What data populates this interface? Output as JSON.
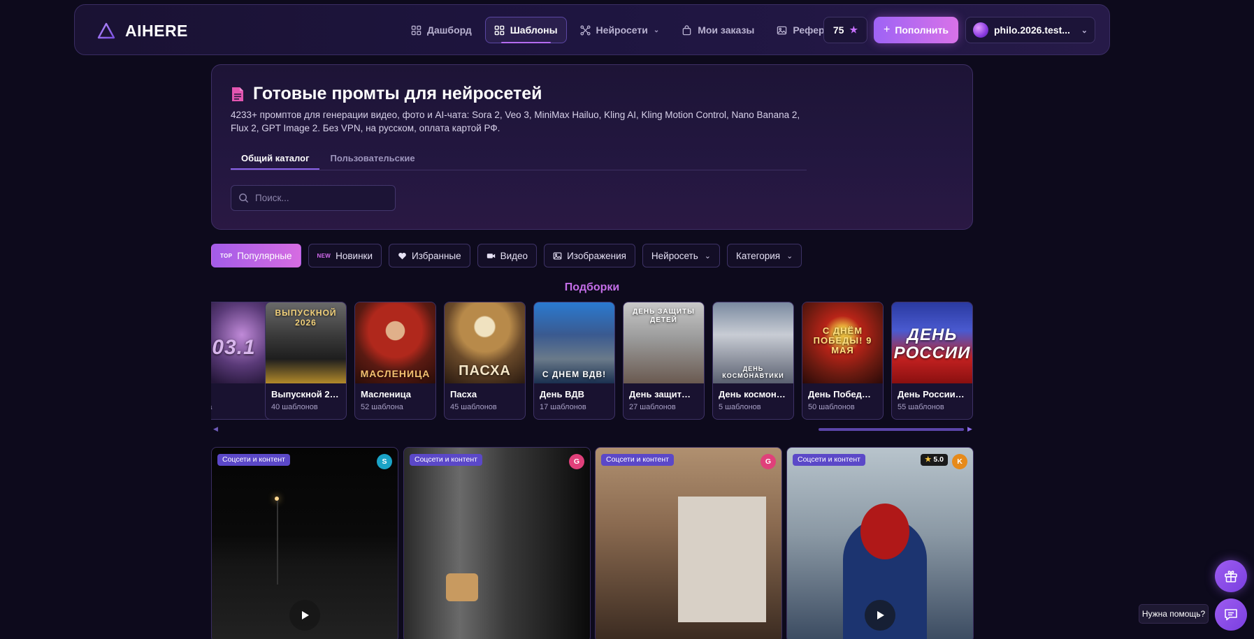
{
  "brand": {
    "name": "AIHERE"
  },
  "nav": {
    "items": [
      {
        "label": "Дашборд",
        "icon": "dashboard-icon"
      },
      {
        "label": "Шаблоны",
        "icon": "grid-icon",
        "active": true
      },
      {
        "label": "Нейросети",
        "icon": "network-icon",
        "has_dropdown": true
      },
      {
        "label": "Мои заказы",
        "icon": "bag-icon"
      },
      {
        "label": "Референсы",
        "icon": "image-icon"
      }
    ]
  },
  "account": {
    "credits": "75",
    "topup_label": "Пополнить",
    "username": "philo.2026.test..."
  },
  "hero": {
    "title": "Готовые промты для нейросетей",
    "description": "4233+ промптов для генерации видео, фото и AI-чата: Sora 2, Veo 3, MiniMax Hailuo, Kling AI, Kling Motion Control, Nano Banana 2, Flux 2, GPT Image 2. Без VPN, на русском, оплата картой РФ.",
    "tabs": [
      {
        "label": "Общий каталог",
        "active": true
      },
      {
        "label": "Пользовательские"
      }
    ],
    "search_placeholder": "Поиск..."
  },
  "filters": {
    "popular_tag": "TOP",
    "popular": "Популярные",
    "new_tag": "NEW",
    "new": "Новинки",
    "favorites": "Избранные",
    "video": "Видео",
    "images": "Изображения",
    "network": "Нейросеть",
    "category": "Категория"
  },
  "collections": {
    "title": "Подборки",
    "items": [
      {
        "name": "",
        "count": "она",
        "art": "03.1"
      },
      {
        "name": "Выпускной 20...",
        "count": "40 шаблонов",
        "art": "ВЫПУСКНОЙ 2026"
      },
      {
        "name": "Масленица",
        "count": "52 шаблона",
        "art": "МАСЛЕНИЦА"
      },
      {
        "name": "Пасха",
        "count": "45 шаблонов",
        "art": "ПАСХА"
      },
      {
        "name": "День ВДВ",
        "count": "17 шаблонов",
        "art": "С ДНЕМ ВДВ!"
      },
      {
        "name": "День защиты ...",
        "count": "27 шаблонов",
        "art": "ДЕНЬ ЗАЩИТЫ ДЕТЕЙ"
      },
      {
        "name": "День космона...",
        "count": "5 шаблонов",
        "art": "ДЕНЬ КОСМОНАВТИКИ"
      },
      {
        "name": "День Победы ...",
        "count": "50 шаблонов",
        "art": "С ДНЁМ ПОБЕДЫ! 9 МАЯ"
      },
      {
        "name": "День России | ...",
        "count": "55 шаблонов",
        "art": "ДЕНЬ РОССИИ"
      }
    ]
  },
  "templates": [
    {
      "badge": "Соцсети и контент",
      "model": "S",
      "model_color": "#1aa3c7",
      "has_play": true
    },
    {
      "badge": "Соцсети и контент",
      "model": "G",
      "model_color": "#e0407a",
      "has_play": false
    },
    {
      "badge": "Соцсети и контент",
      "model": "G",
      "model_color": "#e0407a",
      "has_play": false
    },
    {
      "badge": "Соцсети и контент",
      "model": "K",
      "model_color": "#e68a1a",
      "rating": "5.0",
      "has_play": true
    }
  ],
  "support": {
    "help_label": "Нужна помощь?"
  }
}
